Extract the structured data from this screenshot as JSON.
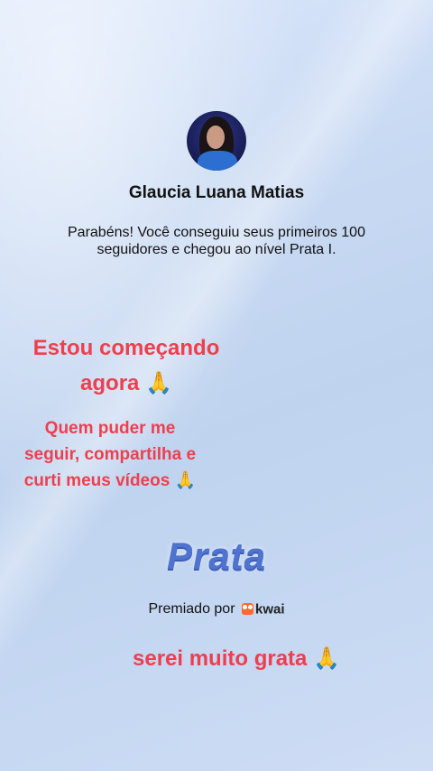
{
  "profile": {
    "name": "Glaucia Luana Matias",
    "message": "Parabéns! Você conseguiu seus primeiros 100 seguidores e chegou ao nível Prata I."
  },
  "overlays": {
    "line1a": "Estou começando",
    "line1b": "agora",
    "line2a": "Quem puder me",
    "line2b": "seguir, compartilha e",
    "line2c": "curti meus vídeos",
    "line3": "serei muito grata",
    "emoji": "🙏"
  },
  "badge": {
    "level": "Prata",
    "awarded_by": "Premiado por",
    "brand": "kwai"
  },
  "colors": {
    "overlay_text": "#ee3f4e",
    "level_text": "#4f73cf",
    "brand": "#ff6a2a"
  }
}
